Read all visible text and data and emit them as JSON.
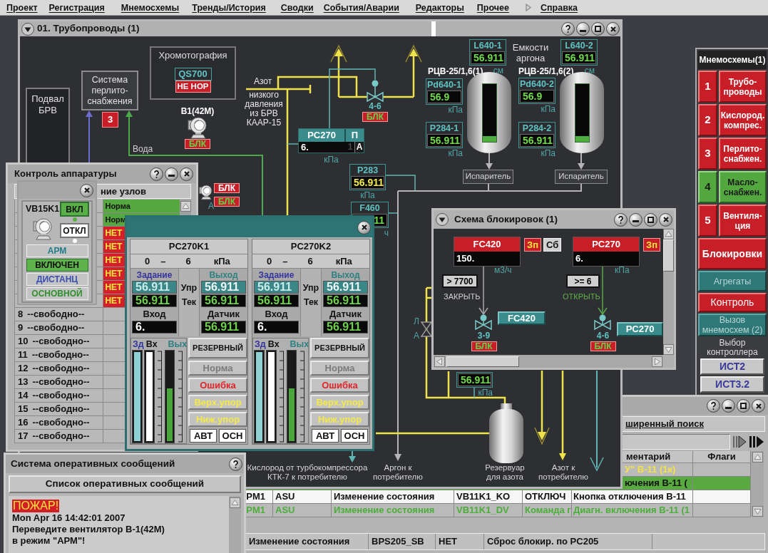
{
  "menu": [
    {
      "label": "Проект",
      "arrow": false
    },
    {
      "label": "Регистрация",
      "arrow": false
    },
    {
      "label": "Мнемосхемы",
      "arrow": false
    },
    {
      "label": "Тренды/История",
      "arrow": false
    },
    {
      "label": "Сводки",
      "arrow": false
    },
    {
      "label": "События/Аварии",
      "arrow": false
    },
    {
      "label": "Редакторы",
      "arrow": false
    },
    {
      "label": "Прочее",
      "arrow": false
    },
    {
      "label": "Справка",
      "arrow": true
    }
  ],
  "main_window": {
    "title": "01. Трубопроводы (1)",
    "diagram": {
      "basement": "Подвал\nБРВ",
      "perlite_system": {
        "label": "Система\nперлито-\nснабжения",
        "badge": "3"
      },
      "chromatography": {
        "title": "Хромотография",
        "tag": "QS700",
        "status": "НЕ НОР"
      },
      "fan": {
        "label": "В1(42М)",
        "badge": {
          "text": "БЛК",
          "active": true
        }
      },
      "water_label": "Вода",
      "nitrogen_source": [
        "Азот",
        "низкого\nдавления\nиз БРВ\nКААР-15"
      ],
      "side_fan": {
        "label": "А",
        "badges": [
          {
            "text": "БЛК",
            "active": false
          },
          {
            "text": "БЛК",
            "active": true
          }
        ]
      },
      "valve": {
        "label": "4-6",
        "badge": {
          "text": "БЛК",
          "active": true
        }
      },
      "controller": {
        "tag": "PC270",
        "mode": "П",
        "value": "6.",
        "channel": "1",
        "auto": "А",
        "unit": "кПа"
      },
      "gauges": [
        {
          "tag": "P283",
          "value": "56.911",
          "unit": "кПа",
          "alarm": true
        },
        {
          "tag": "F460",
          "value": "11",
          "unit": "ч",
          "alarm": false
        },
        {
          "tag": "L640-1",
          "value": "56.911",
          "unit": "см",
          "alarm": false
        },
        {
          "tag": "Pd640-1",
          "value": "56.9",
          "unit": "кПа",
          "alarm": false
        },
        {
          "tag": "P284-1",
          "value": "56.911",
          "unit": "кПа",
          "alarm": false
        },
        {
          "tag": "L640-2",
          "value": "56.911",
          "unit": "см",
          "alarm": false
        },
        {
          "tag": "Pd640-2",
          "value": "56.9",
          "unit": "кПа",
          "alarm": false
        },
        {
          "tag": "P284-2",
          "value": "56.911",
          "unit": "кПа",
          "alarm": false
        },
        {
          "value": "56.911",
          "unit": "кПа",
          "alarm": false
        }
      ],
      "tanks_title": "Емкости\nаргона",
      "tanks": [
        {
          "label": "РЦВ-25/1,6(1)",
          "level": 0.1,
          "evaporator": "Испаритель"
        },
        {
          "label": "РЦВ-25/1,6(2)",
          "level": 0.1,
          "evaporator": "Испаритель"
        }
      ],
      "manual_valve": {
        "top": "Л",
        "bottom": "А"
      },
      "reservoir": "Резервуар\nдля азота",
      "outlets": [
        "Кислород от турбокомпрессора\nКТК-7 к потребителю",
        "Аргон к\nпотребителю",
        "Азот к\nпотребителю"
      ]
    }
  },
  "schemes_panel": {
    "title": "Мнемосхемы(1)",
    "items": [
      {
        "number": "1",
        "label": "Трубо-\nпроводы",
        "alarm": true
      },
      {
        "number": "2",
        "label": "Кислород.\nкомпрес.",
        "alarm": true
      },
      {
        "number": "3",
        "label": "Перлито-\nснабжен.",
        "alarm": true
      },
      {
        "number": "4",
        "label": "Масло-\nснабжен.",
        "alarm": false
      },
      {
        "number": "5",
        "label": "Вентиля-\nция",
        "alarm": true
      }
    ],
    "buttons": [
      {
        "label": "Блокировки",
        "kind": "section"
      },
      {
        "label": "Агрегаты",
        "kind": "normal"
      },
      {
        "label": "Контроль",
        "kind": "alarm"
      },
      {
        "label": "Вызов\nмнемосхем (2)",
        "kind": "normal"
      }
    ],
    "controller_label": "Выбор\nконтроллера",
    "controllers": [
      "ИСТ2",
      "ИСТ3.2"
    ]
  },
  "interlocks_window": {
    "title": "Схема блокировок (1)",
    "loops": [
      {
        "tag": "FC420",
        "value": "150.",
        "unit": "м3/ч",
        "buttons": [
          {
            "label": "Зп",
            "kind": "alarm"
          },
          {
            "label": "Сб",
            "kind": "reset"
          }
        ],
        "condition": "> 7700",
        "action": {
          "label": "ЗАКРЫТЬ",
          "kind": "close"
        },
        "link": "FC420",
        "valve": "3-9",
        "badge": {
          "text": "БЛК",
          "active": true
        }
      },
      {
        "tag": "PC270",
        "value": "6.",
        "unit": "кПа",
        "buttons": [
          {
            "label": "Зп",
            "kind": "alarm"
          }
        ],
        "condition": ">= 6",
        "action": {
          "label": "ОТКРЫТЬ",
          "kind": "open"
        },
        "link": "PC270",
        "valve": "4-6",
        "badge": {
          "text": "БЛК",
          "active": true
        }
      }
    ]
  },
  "equipment_window": {
    "title": "Контроль аппаратуры",
    "header": "ние узлов",
    "status_rows": [
      {
        "status": "Норма",
        "ok": true
      },
      {
        "status": "Норм",
        "ok": true
      },
      {
        "status": "НЕТ",
        "ok": false
      },
      {
        "status": "НЕТ",
        "ok": false
      },
      {
        "status": "НЕТ",
        "ok": false
      },
      {
        "status": "НЕТ",
        "ok": false
      },
      {
        "status": "НЕТ",
        "ok": false
      },
      {
        "status": "НЕТ",
        "ok": false
      }
    ],
    "free_rows": [
      {
        "number": "8",
        "label": "--свободно--"
      },
      {
        "number": "9",
        "label": "--свободно--"
      },
      {
        "number": "10",
        "label": "--свободно--"
      },
      {
        "number": "11",
        "label": "--свободно--"
      },
      {
        "number": "12",
        "label": "--свободно--"
      },
      {
        "number": "13",
        "label": "--свободно--"
      },
      {
        "number": "14",
        "label": "--свободно--"
      },
      {
        "number": "15",
        "label": "--свободно--"
      },
      {
        "number": "16",
        "label": "--свободно--"
      },
      {
        "number": "17",
        "label": "--свободно--"
      }
    ]
  },
  "unit_window": {
    "tag": "VB15K1",
    "switches": [
      {
        "label": "ВКЛ",
        "active": true
      },
      {
        "label": "ОТКЛ",
        "active": false
      }
    ],
    "modes": [
      {
        "label": "АРМ",
        "color": "#1f7d8c",
        "active": false
      },
      {
        "label": "ВКЛЮЧЕН",
        "color": "#5db34a",
        "active": true
      },
      {
        "label": "ДИСТАНЦ",
        "color": "#3a4fb0",
        "active": false
      },
      {
        "label": "ОСНОВНОЙ",
        "color": "#2f8f2c",
        "active": false
      }
    ]
  },
  "faceplate_window": {
    "panels": [
      {
        "tag": "PC270K1",
        "range": {
          "low": "0",
          "dash": "–",
          "high": "6",
          "unit": "кПа"
        },
        "setpoint_label": "Задание",
        "output_label": "Выход",
        "control_label": "Упр",
        "current_label": "Тек",
        "setpoint": "56.911",
        "setpoint_current": "56.911",
        "output": "56.911",
        "output_current": "56.911",
        "input_label": "Вход",
        "input": "6.",
        "sensor_label": "Датчик",
        "sensor": "56.911",
        "bars": [
          {
            "label": "Зд",
            "level": 1
          },
          {
            "label": "Вх",
            "level": 1
          },
          {
            "label": "Вых",
            "level": 0.59
          }
        ],
        "mode": "РЕЗЕРВНЫЙ",
        "indicators": [
          {
            "label": "Норма",
            "kind": "normal"
          },
          {
            "label": "Ошибка",
            "kind": "error"
          },
          {
            "label": "Верх.упор",
            "kind": "limit"
          },
          {
            "label": "Ниж.упор",
            "kind": "limit"
          }
        ],
        "buttons": [
          "АВТ",
          "ОСН"
        ]
      },
      {
        "tag": "PC270K2",
        "range": {
          "low": "0",
          "dash": "–",
          "high": "6",
          "unit": "кПа"
        },
        "setpoint_label": "Задание",
        "output_label": "Выход",
        "control_label": "Упр",
        "current_label": "Тек",
        "setpoint": "56.911",
        "setpoint_current": "56.911",
        "output": "56.911",
        "output_current": "56.911",
        "input_label": "Вход",
        "input": "6.",
        "sensor_label": "Датчик",
        "sensor": "56.911",
        "bars": [
          {
            "label": "Зд",
            "level": 1
          },
          {
            "label": "Вх",
            "level": 1
          },
          {
            "label": "Вых",
            "level": 0.59
          }
        ],
        "mode": "РЕЗЕРВНЫЙ",
        "indicators": [
          {
            "label": "Норма",
            "kind": "normal"
          },
          {
            "label": "Ошибка",
            "kind": "error"
          },
          {
            "label": "Верх.упор",
            "kind": "limit"
          },
          {
            "label": "Ниж.упор",
            "kind": "limit"
          }
        ],
        "buttons": [
          "АВТ",
          "ОСН"
        ]
      }
    ]
  },
  "messages_window": {
    "title": "Система оперативных сообщений",
    "list_title": "Список оперативных сообщений",
    "messages": [
      {
        "alert": "ПОЖАР!",
        "time": "Mon Apr 16 14:42:01 2007",
        "text": "Переведите вентилятор В-1(42М)\nв режим \"АРМ\"!"
      }
    ]
  },
  "events_window": {
    "search": "ширенный поиск",
    "columns": [
      "ментарий",
      "Флаги"
    ],
    "rows": [
      {
        "kind": "warning",
        "comment": "У\" В-11 (1к)"
      },
      {
        "kind": "highlight",
        "comment": "ючения В-11 ("
      },
      {
        "kind": "normal",
        "cells": [
          "PM1",
          "ASU",
          "Изменение состояния",
          "VB11K1_KO",
          "ОТКЛЮЧ"
        ],
        "comment": "Кнопка отключения В-11"
      },
      {
        "kind": "info",
        "cells": [
          "PM1",
          "ASU",
          "Изменение состояния",
          "VB11K1_DV",
          "Команда г"
        ],
        "comment": "Диагн. включения В-11 (1"
      }
    ],
    "status_bar": [
      "Изменение состояния",
      "BPS205_SB",
      "НЕТ",
      "Сброс блокир. по PC205"
    ]
  }
}
